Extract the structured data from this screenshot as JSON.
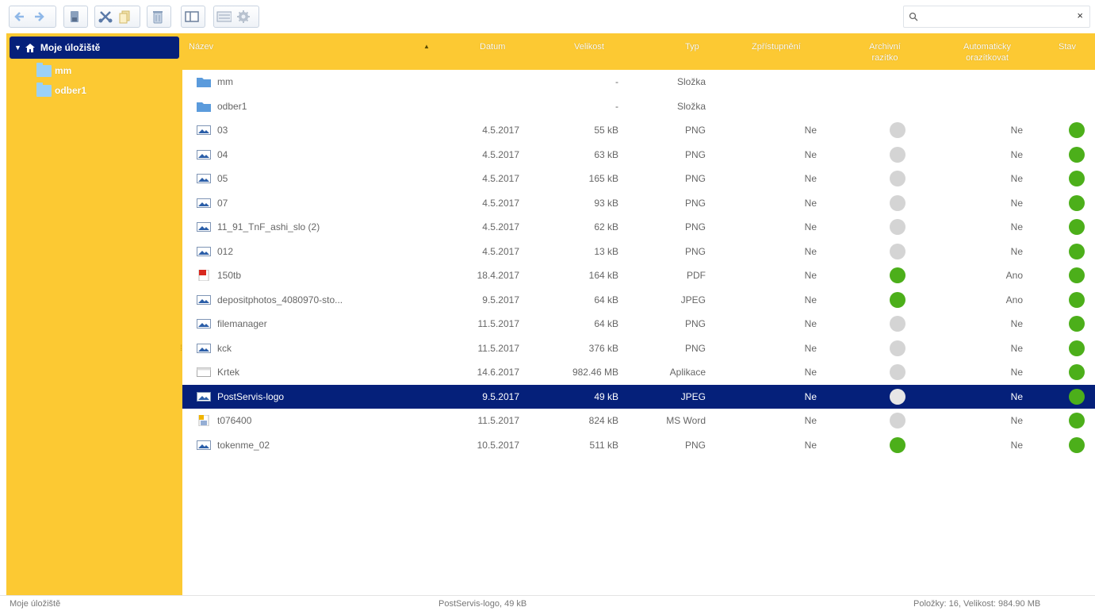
{
  "toolbar": {
    "buttons": [
      {
        "name": "back-button",
        "icon": "arrow-left-icon"
      },
      {
        "name": "forward-button",
        "icon": "arrow-right-icon"
      },
      {
        "name": "upload-button",
        "icon": "upload-icon"
      },
      {
        "name": "cut-button",
        "icon": "scissors-icon"
      },
      {
        "name": "copy-button",
        "icon": "copy-icon"
      },
      {
        "name": "delete-button",
        "icon": "trash-icon"
      },
      {
        "name": "preview-button",
        "icon": "preview-panel-icon"
      },
      {
        "name": "view-button",
        "icon": "view-list-icon"
      },
      {
        "name": "settings-button",
        "icon": "gear-icon"
      }
    ]
  },
  "search": {
    "value": "",
    "placeholder": "",
    "clear_label": "×"
  },
  "tree": {
    "root_label": "Moje úložiště",
    "items": [
      {
        "label": "mm"
      },
      {
        "label": "odber1"
      }
    ]
  },
  "columns": {
    "name": "Název",
    "date": "Datum",
    "size": "Velikost",
    "type": "Typ",
    "public": "Zpřístupnění",
    "archive": "Archivní razítko",
    "auto": "Automaticky orazítkovat",
    "status": "Stav"
  },
  "files": [
    {
      "name": "mm",
      "date": "",
      "size": "-",
      "type": "Složka",
      "public": "",
      "archive": "",
      "auto": "",
      "status": "",
      "icon": "folder-icon"
    },
    {
      "name": "odber1",
      "date": "",
      "size": "-",
      "type": "Složka",
      "public": "",
      "archive": "",
      "auto": "",
      "status": "",
      "icon": "folder-icon"
    },
    {
      "name": "03",
      "date": "4.5.2017",
      "size": "55 kB",
      "type": "PNG",
      "public": "Ne",
      "archive": "gray",
      "auto": "Ne",
      "status": "green",
      "icon": "image-icon"
    },
    {
      "name": "04",
      "date": "4.5.2017",
      "size": "63 kB",
      "type": "PNG",
      "public": "Ne",
      "archive": "gray",
      "auto": "Ne",
      "status": "green",
      "icon": "image-icon"
    },
    {
      "name": "05",
      "date": "4.5.2017",
      "size": "165 kB",
      "type": "PNG",
      "public": "Ne",
      "archive": "gray",
      "auto": "Ne",
      "status": "green",
      "icon": "image-icon"
    },
    {
      "name": "07",
      "date": "4.5.2017",
      "size": "93 kB",
      "type": "PNG",
      "public": "Ne",
      "archive": "gray",
      "auto": "Ne",
      "status": "green",
      "icon": "image-icon"
    },
    {
      "name": "11_91_TnF_ashi_slo (2)",
      "date": "4.5.2017",
      "size": "62 kB",
      "type": "PNG",
      "public": "Ne",
      "archive": "gray",
      "auto": "Ne",
      "status": "green",
      "icon": "image-icon"
    },
    {
      "name": "012",
      "date": "4.5.2017",
      "size": "13 kB",
      "type": "PNG",
      "public": "Ne",
      "archive": "gray",
      "auto": "Ne",
      "status": "green",
      "icon": "image-icon"
    },
    {
      "name": "150tb",
      "date": "18.4.2017",
      "size": "164 kB",
      "type": "PDF",
      "public": "Ne",
      "archive": "green",
      "auto": "Ano",
      "status": "green",
      "icon": "pdf-icon"
    },
    {
      "name": "depositphotos_4080970-sto...",
      "date": "9.5.2017",
      "size": "64 kB",
      "type": "JPEG",
      "public": "Ne",
      "archive": "green",
      "auto": "Ano",
      "status": "green",
      "icon": "image-icon"
    },
    {
      "name": "filemanager",
      "date": "11.5.2017",
      "size": "64 kB",
      "type": "PNG",
      "public": "Ne",
      "archive": "gray",
      "auto": "Ne",
      "status": "green",
      "icon": "image-icon"
    },
    {
      "name": "kck",
      "date": "11.5.2017",
      "size": "376 kB",
      "type": "PNG",
      "public": "Ne",
      "archive": "gray",
      "auto": "Ne",
      "status": "green",
      "icon": "image-icon"
    },
    {
      "name": "Krtek",
      "date": "14.6.2017",
      "size": "982.46 MB",
      "type": "Aplikace",
      "public": "Ne",
      "archive": "gray",
      "auto": "Ne",
      "status": "green",
      "icon": "application-icon"
    },
    {
      "name": "PostServis-logo",
      "date": "9.5.2017",
      "size": "49 kB",
      "type": "JPEG",
      "public": "Ne",
      "archive": "gray",
      "auto": "Ne",
      "status": "green",
      "icon": "image-icon",
      "selected": true
    },
    {
      "name": "t076400",
      "date": "11.5.2017",
      "size": "824 kB",
      "type": "MS Word",
      "public": "Ne",
      "archive": "gray",
      "auto": "Ne",
      "status": "green",
      "icon": "word-document-icon"
    },
    {
      "name": "tokenme_02",
      "date": "10.5.2017",
      "size": "511 kB",
      "type": "PNG",
      "public": "Ne",
      "archive": "green",
      "auto": "Ne",
      "status": "green",
      "icon": "image-icon"
    }
  ],
  "colors": {
    "accent": "#fcc933",
    "selection": "#05207a",
    "green": "#4caf1a",
    "gray": "#d4d4d4"
  },
  "statusbar": {
    "left": "Moje úložiště",
    "center": "PostServis-logo, 49 kB",
    "right": "Položky: 16, Velikost: 984.90 MB"
  }
}
